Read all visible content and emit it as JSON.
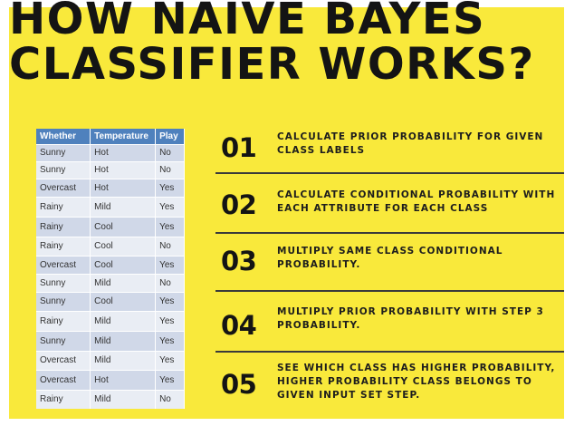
{
  "title": {
    "line1": "HOW NAIVE BAYES",
    "line2": "CLASSIFIER WORKS?"
  },
  "table": {
    "headers": [
      "Whether",
      "Temperature",
      "Play"
    ],
    "rows": [
      [
        "Sunny",
        "Hot",
        "No"
      ],
      [
        "Sunny",
        "Hot",
        "No"
      ],
      [
        "Overcast",
        "Hot",
        "Yes"
      ],
      [
        "Rainy",
        "Mild",
        "Yes"
      ],
      [
        "Rainy",
        "Cool",
        "Yes"
      ],
      [
        "Rainy",
        "Cool",
        "No"
      ],
      [
        "Overcast",
        "Cool",
        "Yes"
      ],
      [
        "Sunny",
        "Mild",
        "No"
      ],
      [
        "Sunny",
        "Cool",
        "Yes"
      ],
      [
        "Rainy",
        "Mild",
        "Yes"
      ],
      [
        "Sunny",
        "Mild",
        "Yes"
      ],
      [
        "Overcast",
        "Mild",
        "Yes"
      ],
      [
        "Overcast",
        "Hot",
        "Yes"
      ],
      [
        "Rainy",
        "Mild",
        "No"
      ]
    ]
  },
  "steps": [
    {
      "number": "01",
      "text": "CALCULATE PRIOR PROBABILITY FOR GIVEN CLASS LABELS"
    },
    {
      "number": "02",
      "text": "CALCULATE CONDITIONAL PROBABILITY WITH EACH ATTRIBUTE FOR EACH CLASS"
    },
    {
      "number": "03",
      "text": "MULTIPLY SAME CLASS CONDITIONAL PROBABILITY."
    },
    {
      "number": "04",
      "text": "MULTIPLY PRIOR PROBABILITY WITH STEP 3 PROBABILITY."
    },
    {
      "number": "05",
      "text": "SEE WHICH CLASS HAS HIGHER PROBABILITY, HIGHER PROBABILITY CLASS BELONGS TO GIVEN INPUT SET STEP."
    }
  ],
  "colors": {
    "background": "#f9e93b",
    "table_header": "#4f81bd",
    "row_odd": "#d0d8e8",
    "row_even": "#e9edf4",
    "text_dark": "#141414"
  }
}
